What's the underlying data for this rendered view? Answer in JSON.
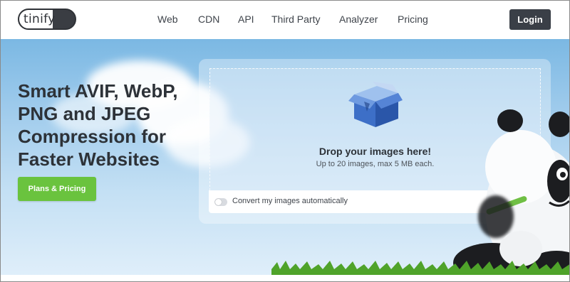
{
  "header": {
    "logo_text": "tinify",
    "nav": [
      {
        "label": "Web"
      },
      {
        "label": "CDN"
      },
      {
        "label": "API"
      },
      {
        "label": "Third Party"
      },
      {
        "label": "Analyzer"
      },
      {
        "label": "Pricing"
      }
    ],
    "login_label": "Login"
  },
  "hero": {
    "headline_lines": [
      "Smart AVIF, WebP,",
      "PNG and JPEG",
      "Compression for",
      "Faster Websites"
    ],
    "cta_label": "Plans & Pricing"
  },
  "dropzone": {
    "icon": "box-icon",
    "title": "Drop your images here!",
    "subtitle": "Up to 20 images, max 5 MB each.",
    "convert_toggle": {
      "label": "Convert my images automatically",
      "checked": false
    }
  },
  "colors": {
    "accent_green": "#6ac33e",
    "login_bg": "#3a3f47",
    "box_blue": "#2f5fb8"
  }
}
